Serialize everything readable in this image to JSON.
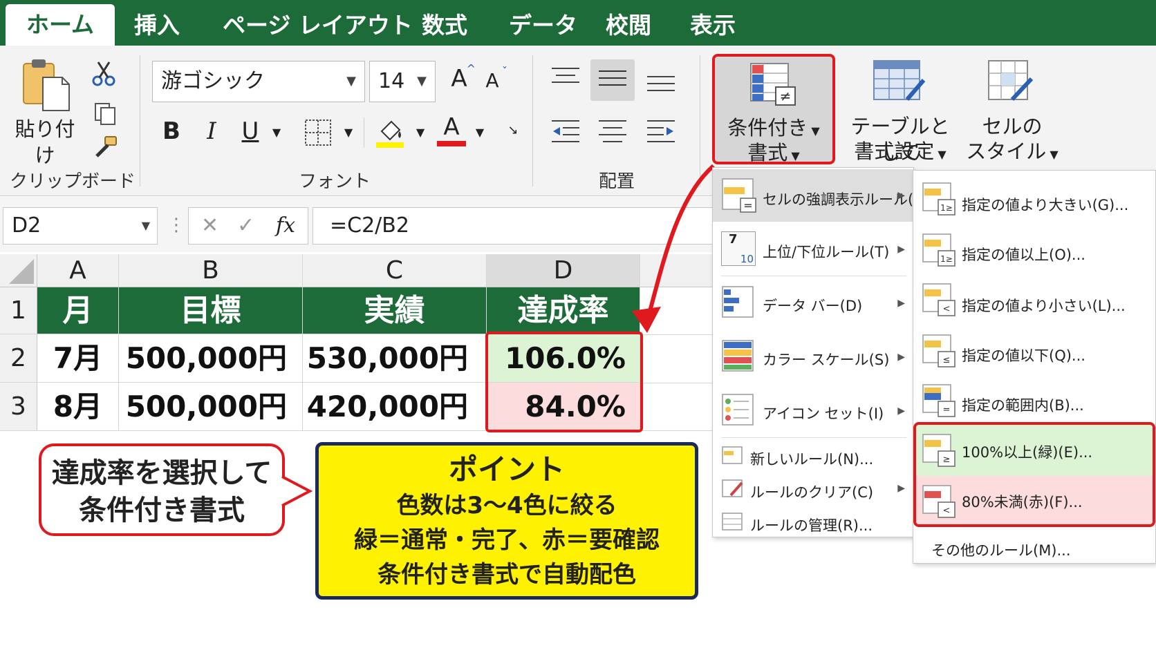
{
  "tabs": [
    "ホーム",
    "挿入",
    "ページ レイアウト",
    "数式",
    "データ",
    "校閲",
    "表示"
  ],
  "ribbon": {
    "paste_label": "貼り付け",
    "clipboard_label": "クリップボード",
    "font_name": "游ゴシック",
    "font_size": "14",
    "font_group_label": "フォント",
    "align_group_label": "配置",
    "cond_format_line1": "条件付き",
    "cond_format_line2": "書式",
    "table_format_line1": "テーブルとして",
    "table_format_line2": "書式設定",
    "cell_style_line1": "セルの",
    "cell_style_line2": "スタイル",
    "bold": "B",
    "italic": "I",
    "underline": "U",
    "grow_font": "A",
    "shrink_font": "A",
    "font_color": "A"
  },
  "formula_bar": {
    "name_box": "D2",
    "fx": "fx",
    "formula": "=C2/B2"
  },
  "grid": {
    "columns": [
      "A",
      "B",
      "C",
      "D"
    ],
    "rows": [
      "1",
      "2",
      "3"
    ],
    "header": [
      "月",
      "目標",
      "実績",
      "達成率"
    ],
    "data": [
      [
        "7月",
        "500,000円",
        "530,000円",
        "106.0%"
      ],
      [
        "8月",
        "500,000円",
        "420,000円",
        "84.0%"
      ]
    ]
  },
  "cond_menu": {
    "items": [
      {
        "label": "セルの強調表示ルール(H)"
      },
      {
        "label": "上位/下位ルール(T)",
        "icon_text_top": "7",
        "icon_text_bottom": "10"
      },
      {
        "label": "データ バー(D)"
      },
      {
        "label": "カラー スケール(S)"
      },
      {
        "label": "アイコン セット(I)"
      },
      {
        "label": "新しいルール(N)..."
      },
      {
        "label": "ルールのクリア(C)"
      },
      {
        "label": "ルールの管理(R)..."
      }
    ]
  },
  "sub_menu": {
    "items": [
      {
        "label": "指定の値より大きい(G)...",
        "sym": "1≥"
      },
      {
        "label": "指定の値以上(O)...",
        "sym": "1≥"
      },
      {
        "label": "指定の値より小さい(L)...",
        "sym": "<"
      },
      {
        "label": "指定の値以下(Q)...",
        "sym": "≤"
      },
      {
        "label": "指定の範囲内(B)...",
        "sym": "="
      },
      {
        "label": "100%以上(緑)(E)...",
        "sym": "≥"
      },
      {
        "label": "80%未満(赤)(F)...",
        "sym": "<"
      },
      {
        "label": "その他のルール(M)..."
      }
    ]
  },
  "callout": {
    "line1": "達成率を選択して",
    "line2": "条件付き書式"
  },
  "point": {
    "title": "ポイント",
    "line1": "色数は3～4色に絞る",
    "line2": "緑＝通常・完了、赤＝要確認",
    "line3": "条件付き書式で自動配色"
  },
  "colors": {
    "excel_green": "#1e6b3a",
    "highlight_red": "#e0191f",
    "cell_green": "#dcf3d4",
    "cell_red": "#fcdcdc",
    "point_yellow": "#fff200",
    "point_border": "#1b2a5e"
  }
}
